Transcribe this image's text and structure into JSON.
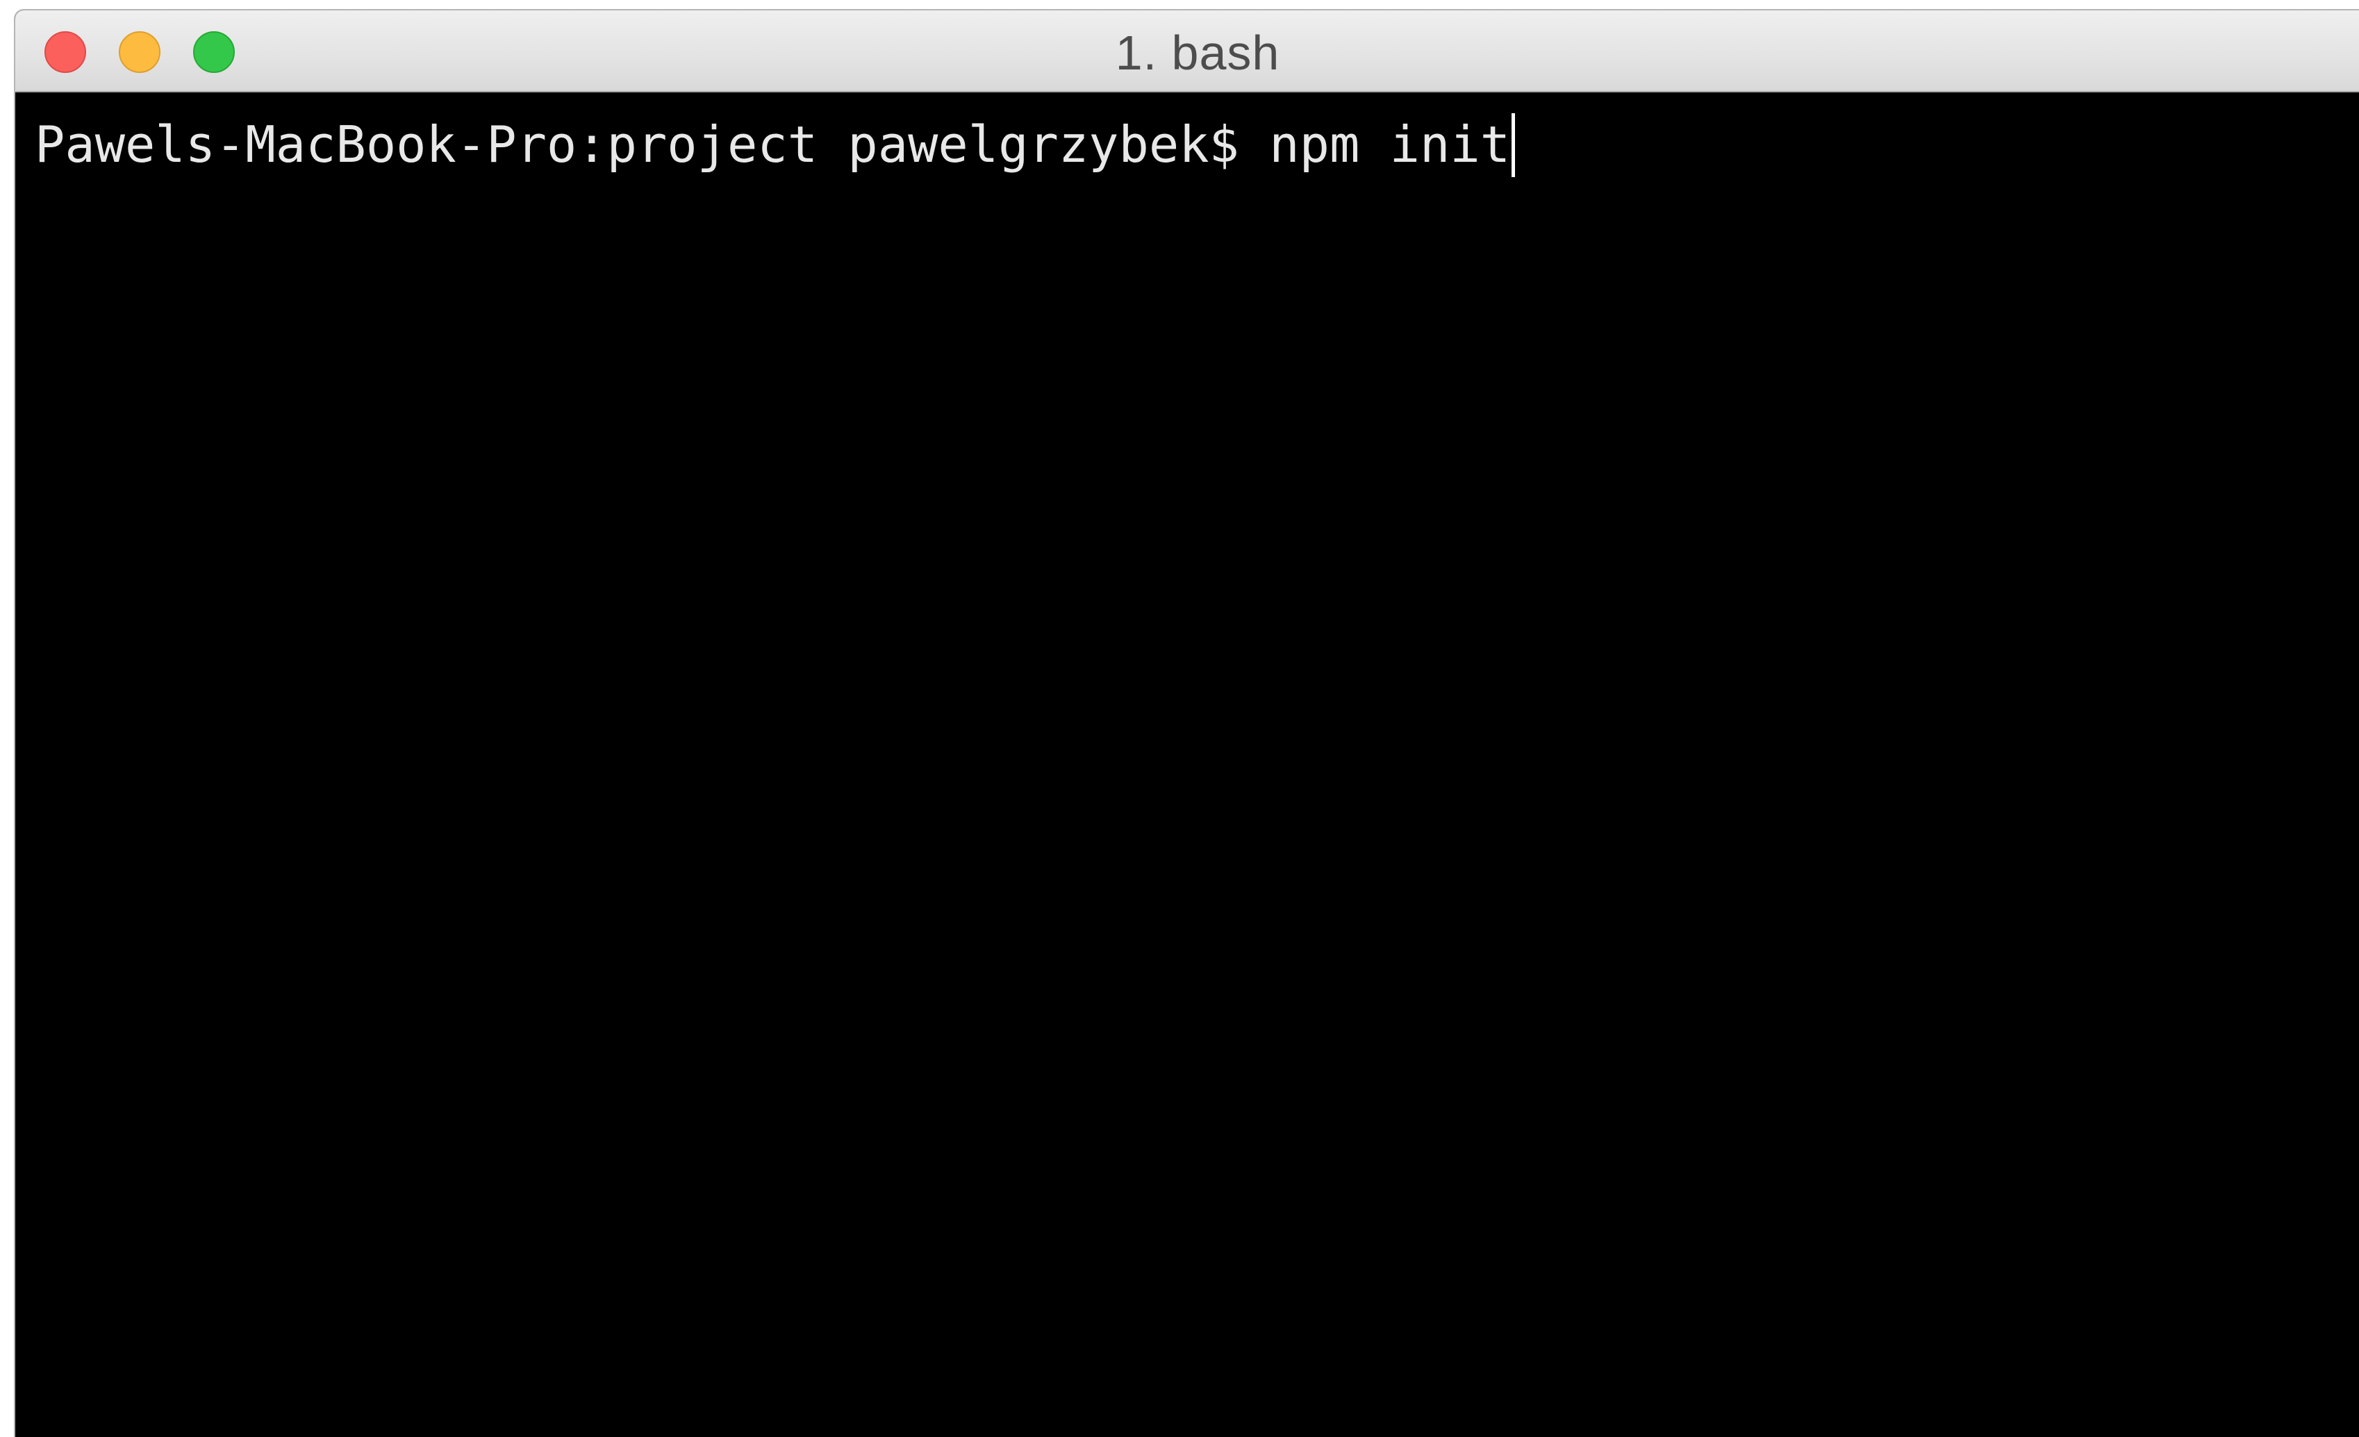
{
  "window": {
    "title": "1. bash"
  },
  "colors": {
    "terminal_background": "#000000",
    "terminal_text": "#e8e8e8",
    "close_button": "#fc605c",
    "minimize_button": "#fdbc40",
    "zoom_button": "#34c84a"
  },
  "terminal": {
    "prompt": "Pawels-MacBook-Pro:project pawelgrzybek$ ",
    "command": "npm init"
  }
}
